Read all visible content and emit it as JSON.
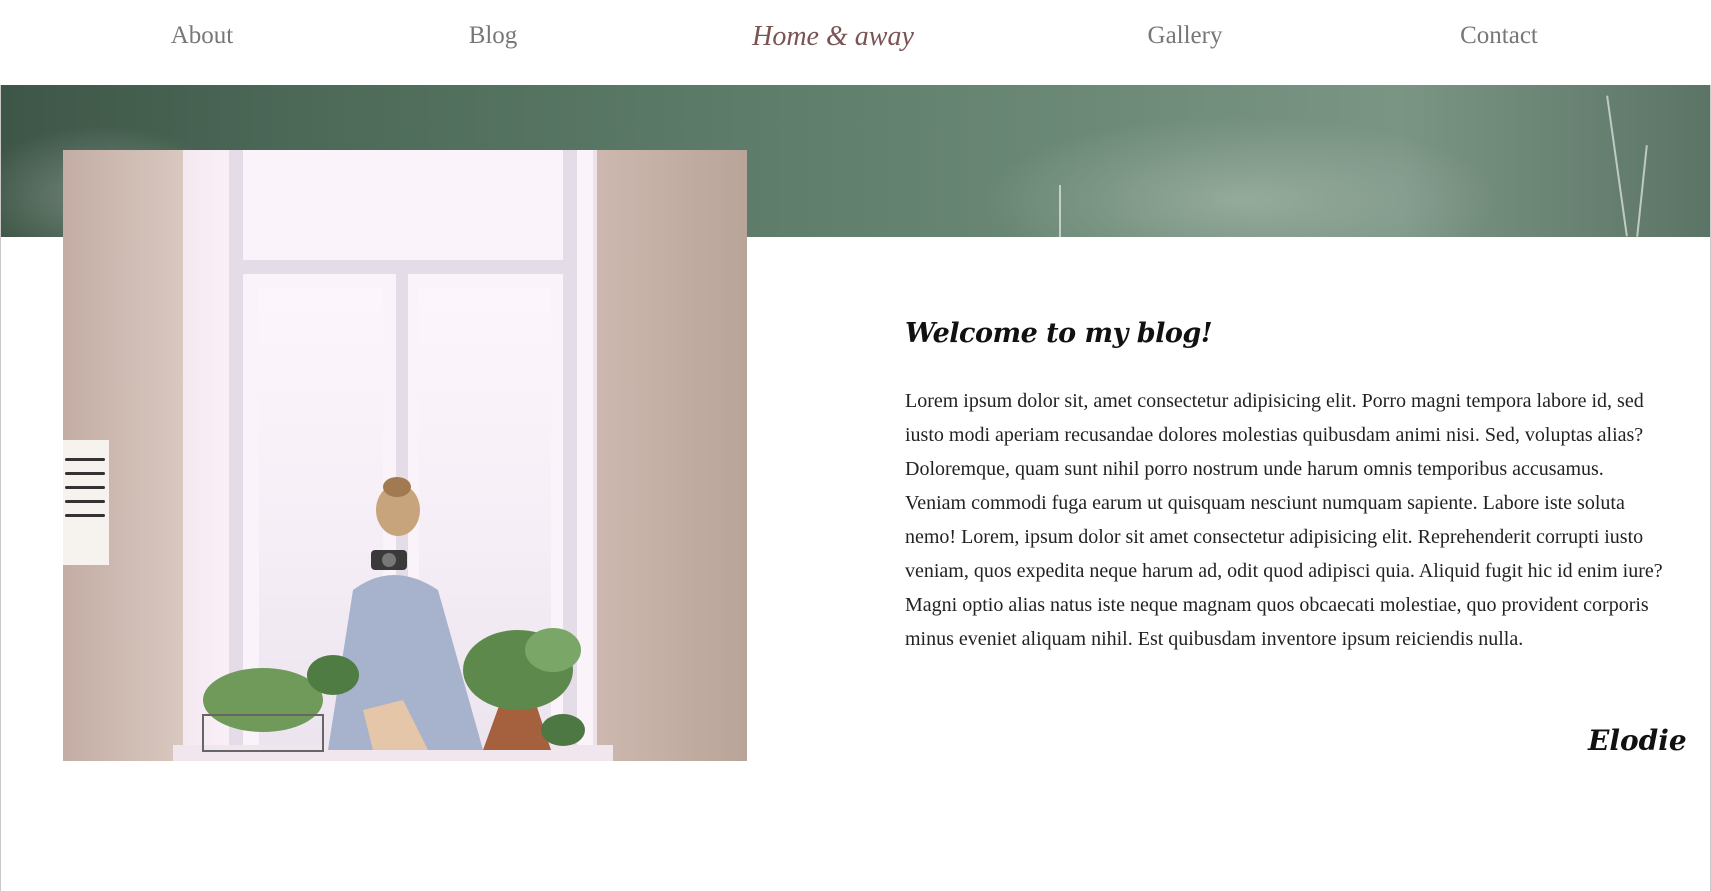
{
  "nav": {
    "items": [
      {
        "label": "About"
      },
      {
        "label": "Blog"
      },
      {
        "label": "Home & away"
      },
      {
        "label": "Gallery"
      },
      {
        "label": "Contact"
      }
    ],
    "active_label": "Home & away"
  },
  "hero": {
    "band_color": "#5f7d6b",
    "photo_description": "photo"
  },
  "post": {
    "heading": "Welcome to my blog!",
    "body": "Lorem ipsum dolor sit, amet consectetur adipisicing elit. Porro magni tempora labore id, sed iusto modi aperiam recusandae dolores molestias quibusdam animi nisi. Sed, voluptas alias? Doloremque, quam sunt nihil porro nostrum unde harum omnis temporibus accusamus. Veniam commodi fuga earum ut quisquam nesciunt numquam sapiente. Labore iste soluta nemo! Lorem, ipsum dolor sit amet consectetur adipisicing elit. Reprehenderit corrupti iusto veniam, quos expedita neque harum ad, odit quod adipisci quia. Aliquid fugit hic id enim iure? Magni optio alias natus iste neque magnam quos obcaecati molestiae, quo provident corporis minus eveniet aliquam nihil. Est quibusdam inventore ipsum reiciendis nulla.",
    "signature": "Elodie"
  },
  "colors": {
    "nav_text": "#777777",
    "nav_active": "#7a5454",
    "heading": "#111111"
  }
}
